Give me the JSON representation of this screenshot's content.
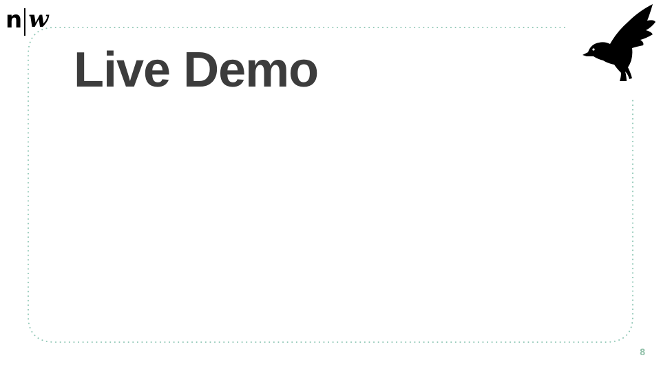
{
  "logo": {
    "left": "n",
    "right": "w"
  },
  "slide": {
    "title": "Live Demo",
    "page_number": "8"
  },
  "mascot": {
    "icon": "bird-icon"
  },
  "colors": {
    "frame_dots": "#8fc7b5",
    "title": "#3c3c3c",
    "page_number": "#8fbfa8",
    "logo": "#000000"
  }
}
